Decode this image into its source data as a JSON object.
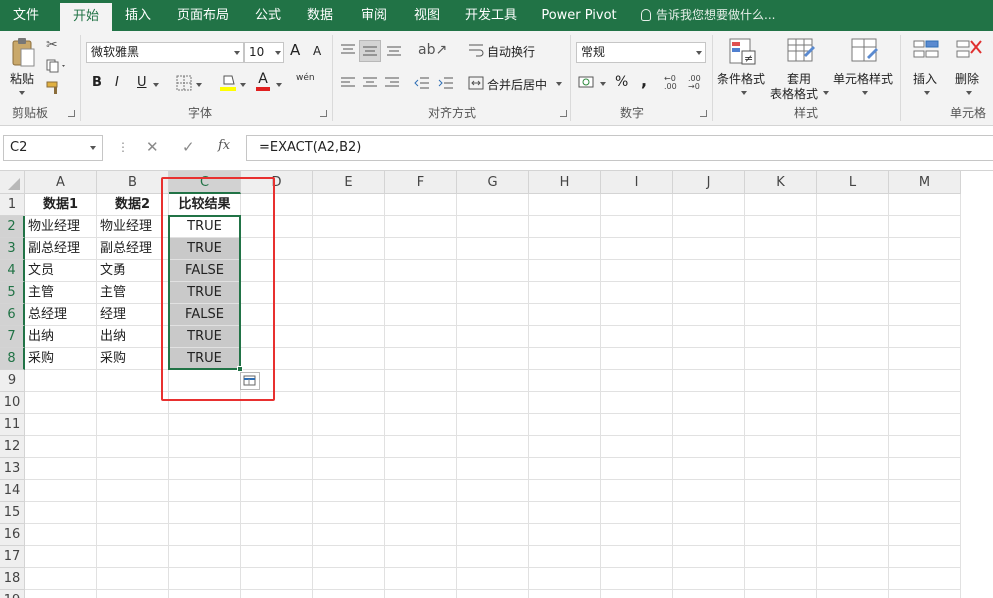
{
  "ribbon_tabs": [
    "文件",
    "开始",
    "插入",
    "页面布局",
    "公式",
    "数据",
    "审阅",
    "视图",
    "开发工具",
    "Power Pivot"
  ],
  "active_tab": "开始",
  "tell_me": "告诉我您想要做什么...",
  "clipboard": {
    "paste": "粘贴",
    "group": "剪贴板"
  },
  "font": {
    "name": "微软雅黑",
    "size": "10",
    "group": "字体",
    "bold": "B",
    "italic": "I",
    "underline": "U",
    "grow": "A",
    "shrink": "A",
    "font_color_glyph": "A",
    "phonetic": "wén"
  },
  "alignment": {
    "wrap": "自动换行",
    "merge": "合并后居中",
    "group": "对齐方式"
  },
  "number": {
    "format": "常规",
    "percent": "%",
    "comma": ",",
    "group": "数字"
  },
  "styles": {
    "conditional": "条件格式",
    "table_line1": "套用",
    "table_line2": "表格格式",
    "cell_styles": "单元格样式",
    "group": "样式"
  },
  "cells": {
    "insert": "插入",
    "delete": "删除",
    "group": "单元格"
  },
  "formula_bar": {
    "name_box": "C2",
    "formula": "=EXACT(A2,B2)",
    "fx": "fx"
  },
  "columns": [
    "A",
    "B",
    "C",
    "D",
    "E",
    "F",
    "G",
    "H",
    "I",
    "J",
    "K",
    "L",
    "M"
  ],
  "rows": [
    "1",
    "2",
    "3",
    "4",
    "5",
    "6",
    "7",
    "8",
    "9",
    "10",
    "11",
    "12",
    "13",
    "14",
    "15",
    "16",
    "17",
    "18",
    "19"
  ],
  "sheet": {
    "headers": [
      "数据1",
      "数据2",
      "比较结果"
    ],
    "rows": [
      [
        "物业经理",
        "物业经理",
        "TRUE"
      ],
      [
        "副总经理",
        "副总经理",
        "TRUE"
      ],
      [
        "文员",
        "文勇",
        "FALSE"
      ],
      [
        "主管",
        "主管",
        "TRUE"
      ],
      [
        "总经理",
        "经理",
        "FALSE"
      ],
      [
        "出纳",
        "出纳",
        "TRUE"
      ],
      [
        "采购",
        "采购",
        "TRUE"
      ]
    ]
  },
  "colors": {
    "accent": "#217346",
    "highlight": "#e8302f",
    "selection_fill": "#c9c9c9"
  }
}
